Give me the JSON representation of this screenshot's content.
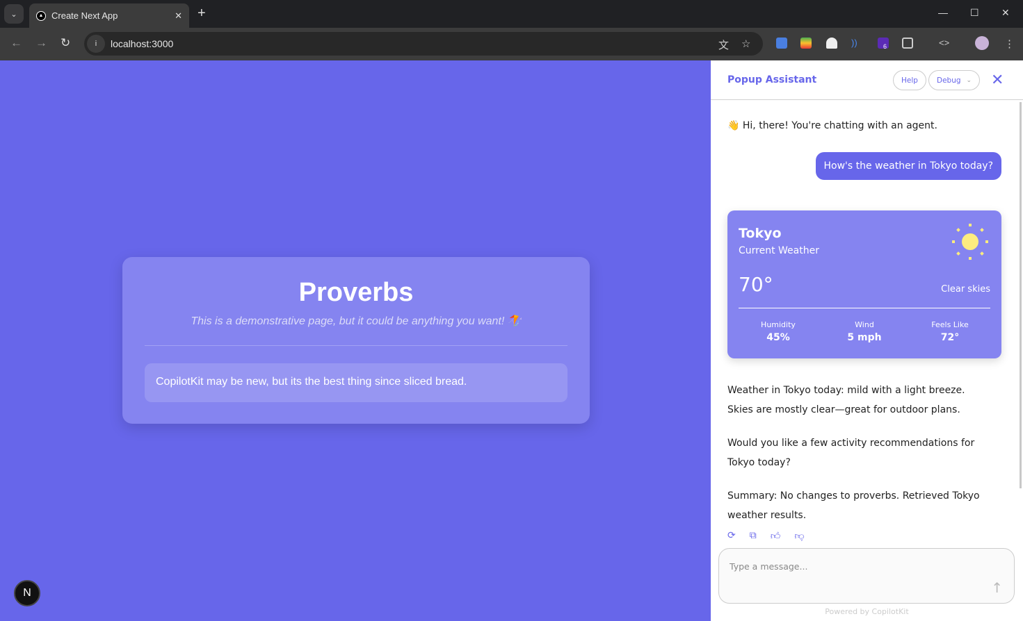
{
  "browser": {
    "tab_title": "Create Next App",
    "url": "localhost:3000",
    "extension_badge": "6"
  },
  "page": {
    "title": "Proverbs",
    "subtitle": "This is a demonstrative page, but it could be anything you want! 🪁",
    "proverbs": [
      "CopilotKit may be new, but its the best thing since sliced bread."
    ],
    "badge_letter": "N"
  },
  "panel": {
    "title": "Popup Assistant",
    "help": "Help",
    "debug": "Debug",
    "greeting": "👋 Hi, there! You're chatting with an agent.",
    "user_message": "How's the weather in Tokyo today?",
    "weather": {
      "city": "Tokyo",
      "subtitle": "Current Weather",
      "temp": "70°",
      "condition": "Clear skies",
      "stats": [
        {
          "label": "Humidity",
          "value": "45%"
        },
        {
          "label": "Wind",
          "value": "5 mph"
        },
        {
          "label": "Feels Like",
          "value": "72°"
        }
      ]
    },
    "replies": [
      "Weather in Tokyo today: mild with a light breeze. Skies are mostly clear—great for outdoor plans.",
      "Would you like a few activity recommendations for Tokyo today?",
      "Summary: No changes to proverbs. Retrieved Tokyo weather results."
    ],
    "input_placeholder": "Type a message...",
    "powered": "Powered by CopilotKit"
  },
  "colors": {
    "accent": "#6766ea",
    "card": "#8584f0",
    "sun": "#fdec7f"
  }
}
